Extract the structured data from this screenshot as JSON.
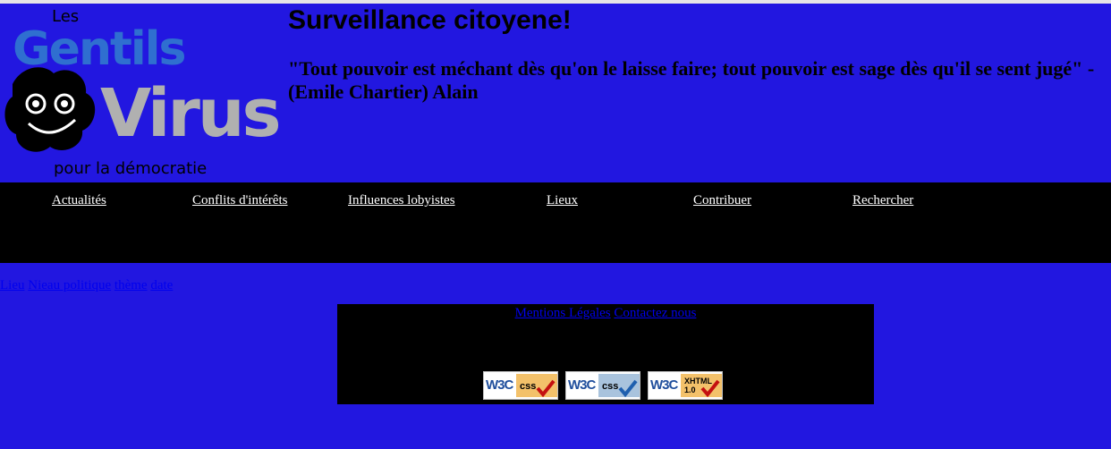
{
  "header": {
    "logo_text": {
      "les": "Les",
      "gentils": "Gentils",
      "virus": "Virus",
      "tagline": "pour la démocratie"
    },
    "title": "Surveillance citoyene!",
    "quote": "\"Tout pouvoir est méchant dès qu'on le laisse faire; tout pouvoir est sage dès qu'il se sent jugé\" - (Emile Chartier) Alain"
  },
  "nav": {
    "items": [
      {
        "label": "Actualités"
      },
      {
        "label": "Conflits d'intérêts"
      },
      {
        "label": "Influences lobyistes"
      },
      {
        "label": "Lieux"
      },
      {
        "label": "Contribuer"
      },
      {
        "label": "Rechercher"
      }
    ]
  },
  "filters": {
    "lieu": "Lieu",
    "niveau": "Nieau politique",
    "theme": "thème",
    "date": "date"
  },
  "footer": {
    "mentions": "Mentions Légales",
    "contact": "Contactez nous",
    "badges": [
      {
        "logo": "W3C",
        "label": "css",
        "icon": "checkmark-red-icon",
        "panel_color": "#f3c16a"
      },
      {
        "logo": "W3C",
        "label": "css",
        "icon": "checkmark-blue-icon",
        "panel_color": "#a9c3dd"
      },
      {
        "logo": "W3C",
        "label": "XHTML 1.0",
        "icon": "checkmark-red-icon",
        "panel_color": "#f3c16a"
      }
    ]
  },
  "colors": {
    "background": "#2217e0",
    "nav_background": "#000000",
    "link": "#0000ee",
    "logo_blue": "#2f6fd0",
    "logo_grey": "#b0b0b0"
  }
}
